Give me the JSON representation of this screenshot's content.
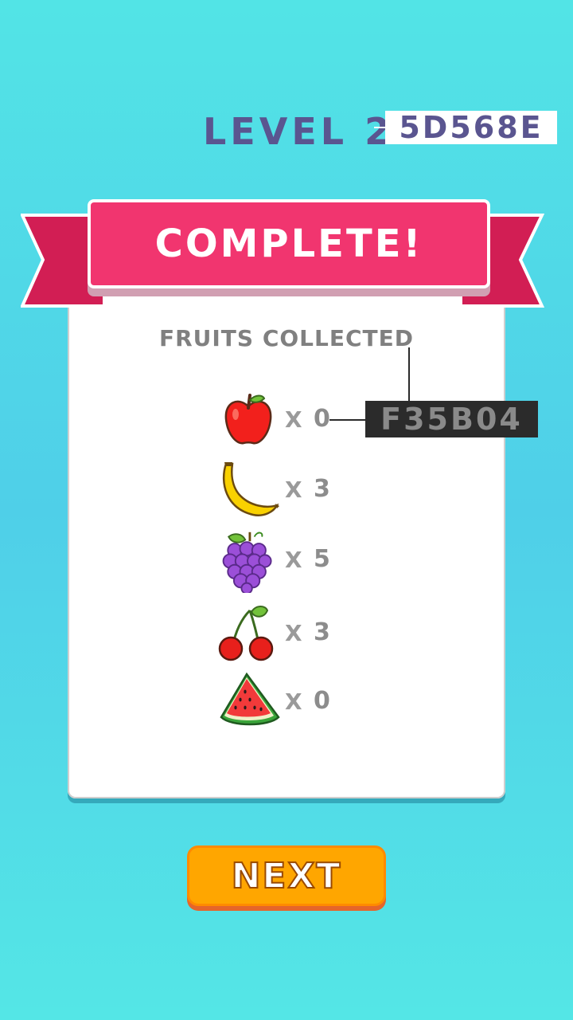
{
  "header": {
    "level_label": "LEVEL 2",
    "code_top": "5D568E"
  },
  "banner": {
    "title": "COMPLETE!"
  },
  "card": {
    "heading": "FRUITS COLLECTED",
    "code_mid": "F35B04",
    "fruits": [
      {
        "icon": "apple-icon",
        "multiplier": "X",
        "count": "0"
      },
      {
        "icon": "banana-icon",
        "multiplier": "X",
        "count": "3"
      },
      {
        "icon": "grapes-icon",
        "multiplier": "X",
        "count": "5"
      },
      {
        "icon": "cherry-icon",
        "multiplier": "X",
        "count": "3"
      },
      {
        "icon": "watermelon-icon",
        "multiplier": "X",
        "count": "0"
      }
    ]
  },
  "footer": {
    "next_label": "NEXT"
  },
  "colors": {
    "background": "#52e4e6",
    "ribbon": "#f1356f",
    "level_text": "#5a5590",
    "next_button": "#ffa600"
  }
}
